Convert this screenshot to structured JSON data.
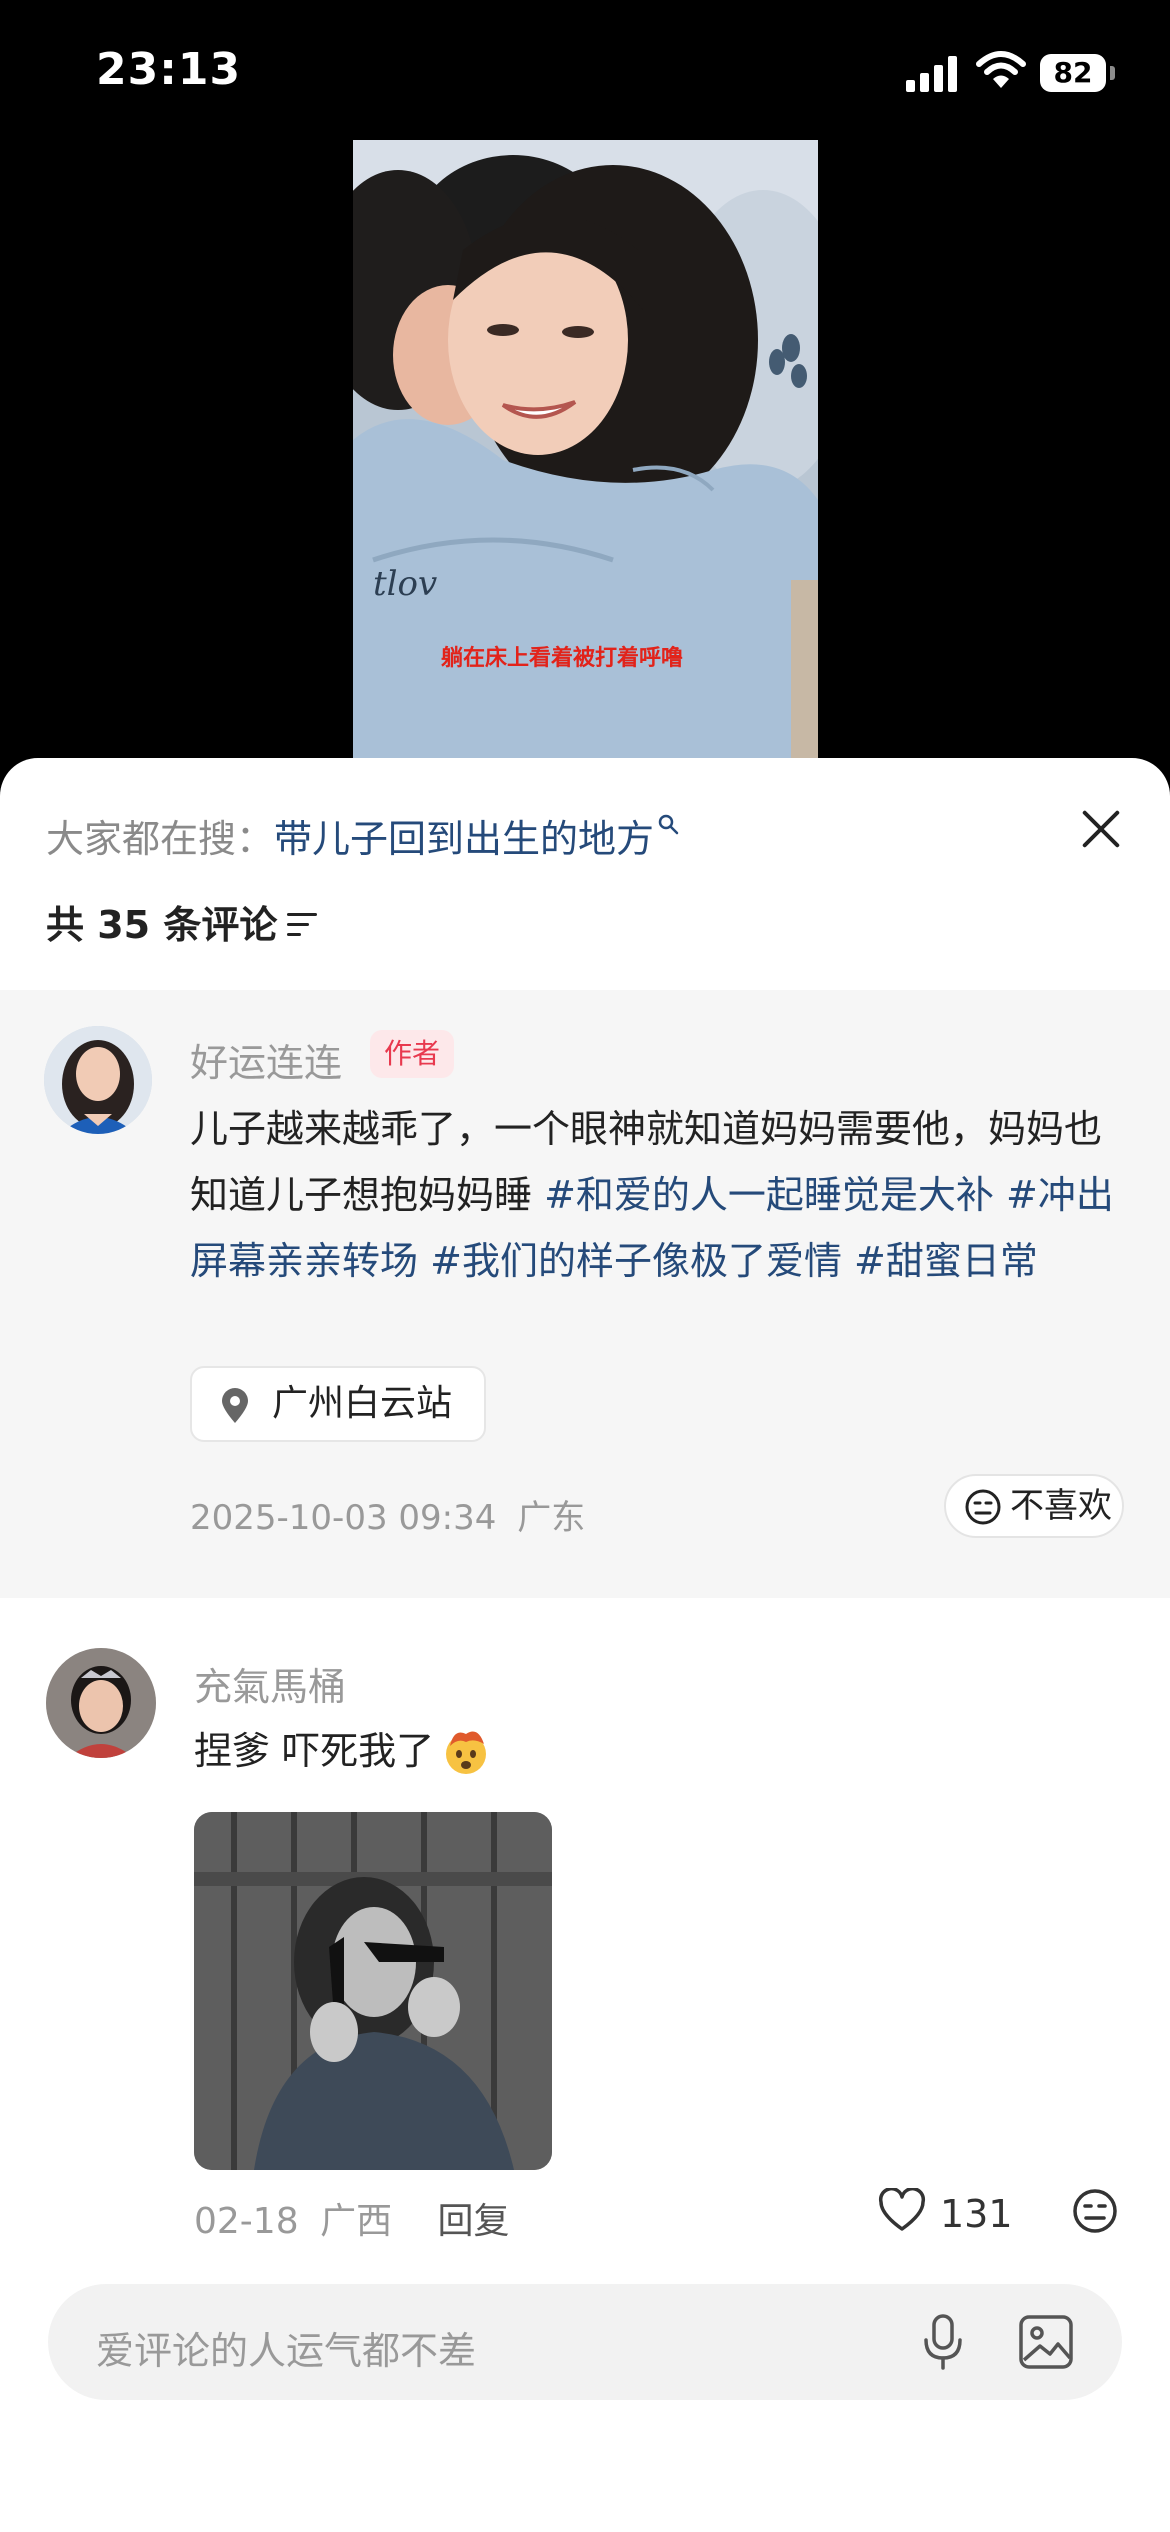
{
  "status_bar": {
    "time": "23:13",
    "battery": "82"
  },
  "video": {
    "caption": "躺在床上看着被打着呼噜"
  },
  "sheet": {
    "search_prefix": "大家都在搜：",
    "search_query": "带儿子回到出生的地方",
    "comment_count": "共 35 条评论"
  },
  "author_comment": {
    "name": "好运连连",
    "tag": "作者",
    "text": "儿子越来越乖了，一个眼神就知道妈妈需要他，妈妈也知道儿子想抱妈妈睡 ",
    "hashtags": [
      "#和爱的人一起睡觉是大补",
      "#冲出屏幕亲亲转场",
      "#我们的样子像极了爱情",
      "#甜蜜日常"
    ],
    "location": "广州白云站",
    "datetime": "2025-10-03 09:34",
    "region": "广东",
    "dislike_label": "不喜欢"
  },
  "comment2": {
    "name": "充氣馬桶",
    "text": "捏爹 吓死我了",
    "date": "02-18",
    "region": "广西",
    "reply_label": "回复",
    "likes": "131"
  },
  "input": {
    "placeholder": "爱评论的人运气都不差"
  },
  "colors": {
    "link": "#254a7a",
    "author_tag": "#e8394e",
    "muted": "#999999"
  }
}
